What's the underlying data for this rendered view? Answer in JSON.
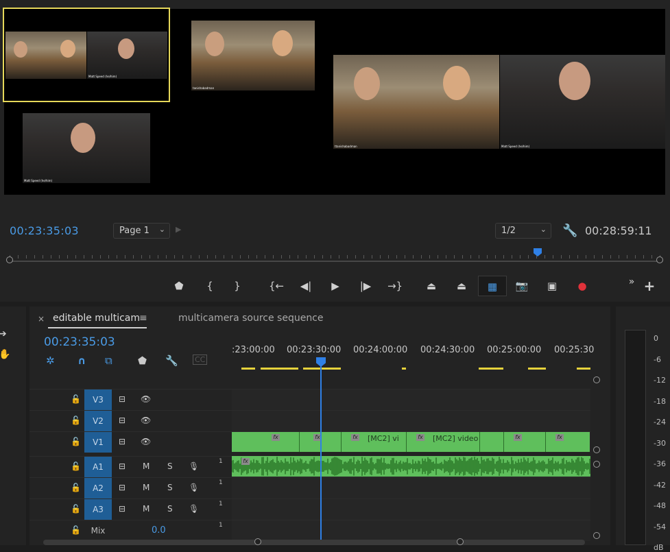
{
  "monitor": {
    "timecode_current": "00:23:35:03",
    "timecode_duration": "00:28:59:11",
    "page_dropdown": "Page 1",
    "resolution_dropdown": "1/2",
    "thumbnails": [
      {
        "caption_left": "",
        "caption_right": "Matt Speed (he/him)"
      },
      {
        "caption_left": "tanishabadman"
      },
      {
        "caption_left": "Matt Speed (he/him)"
      },
      {
        "caption_left": "ttanishabadman",
        "caption_right": "Matt Speed (he/him)"
      }
    ]
  },
  "transport": {
    "buttons": [
      {
        "icon": "marker-icon",
        "glyph": "⬟"
      },
      {
        "icon": "mark-in-icon",
        "glyph": "{"
      },
      {
        "icon": "mark-out-icon",
        "glyph": "}"
      },
      {
        "icon": "go-to-in-icon",
        "glyph": "{←"
      },
      {
        "icon": "step-back-icon",
        "glyph": "◀|"
      },
      {
        "icon": "play-icon",
        "glyph": "▶"
      },
      {
        "icon": "step-forward-icon",
        "glyph": "|▶"
      },
      {
        "icon": "go-to-out-icon",
        "glyph": "→}"
      },
      {
        "icon": "lift-icon",
        "glyph": "⏏"
      },
      {
        "icon": "extract-icon",
        "glyph": "⏏"
      },
      {
        "icon": "multicam-view-icon",
        "glyph": "▦"
      },
      {
        "icon": "export-frame-icon",
        "glyph": "📷"
      },
      {
        "icon": "comparison-view-icon",
        "glyph": "▣"
      },
      {
        "icon": "record-icon",
        "glyph": "●"
      }
    ],
    "more": "»",
    "add": "+"
  },
  "timeline": {
    "tab_active": "editable multicam",
    "tab_close": "×",
    "tab_menu": "≡",
    "tab_other": "multicamera source sequence",
    "timecode": "00:23:35:03",
    "ruler_labels": [
      ":23:00:00",
      "00:23:30:00",
      "00:24:00:00",
      "00:24:30:00",
      "00:25:00:00",
      "00:25:30"
    ],
    "tracks": [
      {
        "name": "V3",
        "kind": "video"
      },
      {
        "name": "V2",
        "kind": "video"
      },
      {
        "name": "V1",
        "kind": "video"
      },
      {
        "name": "A1",
        "kind": "audio",
        "number": "1"
      },
      {
        "name": "A2",
        "kind": "audio",
        "number": "1"
      },
      {
        "name": "A3",
        "kind": "audio",
        "number": "1"
      }
    ],
    "audio_toggles": {
      "mute": "M",
      "solo": "S"
    },
    "mix": {
      "label": "Mix",
      "value": "0.0",
      "number": "1"
    },
    "clip_labels": {
      "fx": "fx",
      "c1": "[MC2] vi",
      "c2": "[MC2] video"
    }
  },
  "meter": {
    "db_labels": [
      "0",
      "-6",
      "-12",
      "-18",
      "-24",
      "-30",
      "-36",
      "-42",
      "-48",
      "-54",
      "dB"
    ]
  },
  "colors": {
    "accent_blue": "#4a9be6",
    "clip_green": "#5fbf5c",
    "track_target_blue": "#1f5e96",
    "selection_yellow": "#e6d85a",
    "record_red": "#e0323a"
  }
}
